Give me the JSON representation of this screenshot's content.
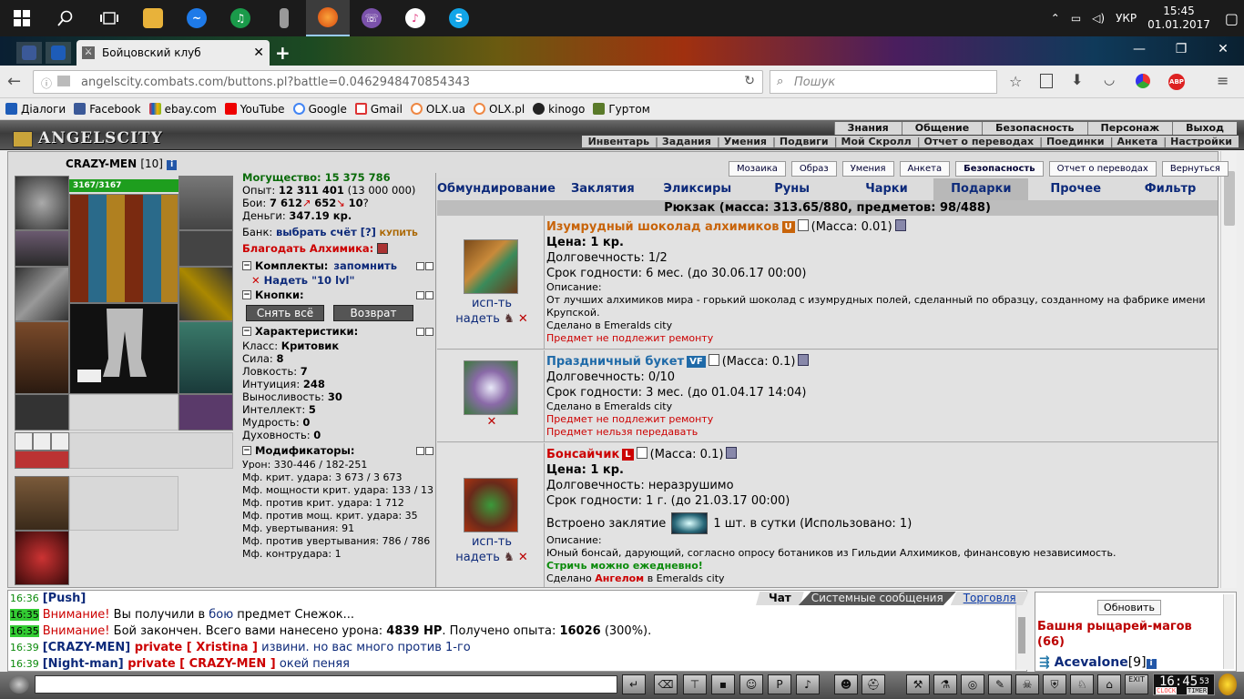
{
  "taskbar": {
    "lang": "УКР",
    "time": "15:45",
    "date": "01.01.2017",
    "apps": [
      "start",
      "search",
      "task-view",
      "explorer",
      "messenger",
      "media",
      "document",
      "firefox",
      "viber",
      "itunes",
      "skype"
    ]
  },
  "browser": {
    "tab_title": "Бойцовский клуб",
    "url": "angelscity.combats.com/buttons.pl?battle=0.0462948470854343",
    "search_placeholder": "Пошук",
    "bookmarks": [
      "Діалоги",
      "Facebook",
      "ebay.com",
      "YouTube",
      "Google",
      "Gmail",
      "OLX.ua",
      "OLX.pl",
      "kinogo",
      "Гуртом"
    ],
    "abp_label": "ABP"
  },
  "game_header": {
    "logo": "ANGELSCITY",
    "top_menu": [
      "Знания",
      "Общение",
      "Безопасность",
      "Персонаж",
      "Выход"
    ],
    "sub_menu": [
      "Инвентарь",
      "Задания",
      "Умения",
      "Подвиги",
      "Мой Скролл",
      "Отчет о переводах",
      "Поединки",
      "Анкета",
      "Настройки"
    ]
  },
  "character": {
    "name": "CRAZY-MEN",
    "level": "[10]",
    "info_icon": "i",
    "hp": "3167/3167",
    "might_label": "Могущество:",
    "might": "15 375 786",
    "exp_label": "Опыт:",
    "exp": "12 311 401",
    "exp_next": "(13 000 000)",
    "fights_label": "Бои:",
    "wins": "7 612",
    "losses": "652",
    "draws": "10",
    "money_label": "Деньги:",
    "money": "347.19 кр.",
    "bank_label": "Банк:",
    "bank_link": "выбрать счёт [?]",
    "bank_buy": "КУПИТЬ",
    "alchemist": "Благодать Алхимика:",
    "sets_label": "Комплекты:",
    "sets_remember": "запомнить",
    "set_item": "Надеть \"10 lvl\"",
    "buttons_label": "Кнопки:",
    "btn_remove_all": "Снять всё",
    "btn_return": "Возврат",
    "traits_label": "Характеристики:",
    "traits": [
      {
        "k": "Класс:",
        "v": "Критовик"
      },
      {
        "k": "Сила:",
        "v": "8"
      },
      {
        "k": "Ловкость:",
        "v": "7"
      },
      {
        "k": "Интуиция:",
        "v": "248"
      },
      {
        "k": "Выносливость:",
        "v": "30"
      },
      {
        "k": "Интеллект:",
        "v": "5"
      },
      {
        "k": "Мудрость:",
        "v": "0"
      },
      {
        "k": "Духовность:",
        "v": "0"
      }
    ],
    "mods_label": "Модификаторы:",
    "mods": [
      "Урон: 330-446 / 182-251",
      "Мф. крит. удара: 3 673 / 3 673",
      "Мф. мощности крит. удара: 133 / 13",
      "Мф. против крит. удара: 1 712",
      "Мф. против мощ. крит. удара: 35",
      "Мф. увертывания: 91",
      "Мф. против увертывания: 786 / 786",
      "Мф. контрудара: 1"
    ]
  },
  "top_buttons": [
    "Мозаика",
    "Образ",
    "Умения",
    "Анкета",
    "Безопасность",
    "Отчет о переводах",
    "Вернуться"
  ],
  "tabs": [
    "Обмундирование",
    "Заклятия",
    "Эликсиры",
    "Руны",
    "Чарки",
    "Подарки",
    "Прочее",
    "Фильтр"
  ],
  "active_tab": "Подарки",
  "backpack_title": "Рюкзак (масса: 313.65/880, предметов: 98/488)",
  "actions": {
    "use": "исп-ть",
    "wear": "надеть"
  },
  "items": [
    {
      "name": "Изумрудный шоколад алхимиков",
      "badge": "U",
      "mass": "(Масса: 0.01)",
      "price": "Цена: 1 кр.",
      "durability": "Долговечность: 1/2",
      "expiry": "Срок годности: 6 мес. (до 30.06.17 00:00)",
      "desc_label": "Описание:",
      "desc": "От лучших алхимиков мира - горький шоколад с изумрудных полей, сделанный по образцу, созданному на фабрике имени Крупской.",
      "made": "Сделано в Emeralds city",
      "note1": "Предмет не подлежит ремонту"
    },
    {
      "name": "Праздничный букет",
      "badge": "VF",
      "mass": "(Масса: 0.1)",
      "durability": "Долговечность: 0/10",
      "expiry": "Срок годности: 3 мес. (до 01.04.17 14:04)",
      "made": "Сделано в Emeralds city",
      "note1": "Предмет не подлежит ремонту",
      "note2": "Предмет нельзя передавать"
    },
    {
      "name": "Бонсайчик",
      "badge": "L",
      "mass": "(Масса: 0.1)",
      "price": "Цена: 1 кр.",
      "durability": "Долговечность: неразрушимо",
      "expiry": "Срок годности: 1 г. (до 21.03.17 00:00)",
      "spell_pre": "Встроено заклятие",
      "spell_post": "1 шт. в сутки (Использовано: 1)",
      "desc_label": "Описание:",
      "desc": "Юный бонсай, дарующий, согласно опросу ботаников из Гильдии Алхимиков, финансовую независимость.",
      "daily": "Стричь можно ежедневно!",
      "made_pre": "Сделано",
      "made_by": "Ангелом",
      "made_post": "в Emeralds city"
    }
  ],
  "chat": {
    "tabs": [
      "Чат",
      "Системные сообщения",
      "Торговля"
    ],
    "lines": [
      {
        "t": "16:36",
        "parts": [
          {
            "c": "b",
            "s": "[Push]"
          }
        ]
      },
      {
        "t": "16:35",
        "hl": true,
        "parts": [
          {
            "c": "r",
            "s": "Внимание!"
          },
          {
            "c": "n",
            "s": " Вы получили в "
          },
          {
            "c": "bl",
            "s": "бою"
          },
          {
            "c": "n",
            "s": " предмет Снежок..."
          }
        ]
      },
      {
        "t": "16:35",
        "hl": true,
        "parts": [
          {
            "c": "r",
            "s": "Внимание!"
          },
          {
            "c": "n",
            "s": " Бой закончен. Всего вами нанесено урона: "
          },
          {
            "c": "k",
            "s": "4839 HP"
          },
          {
            "c": "n",
            "s": ". Получено опыта: "
          },
          {
            "c": "k",
            "s": "16026"
          },
          {
            "c": "n",
            "s": " (300%)."
          }
        ]
      },
      {
        "t": "16:39",
        "parts": [
          {
            "c": "b",
            "s": "[CRAZY-MEN]"
          },
          {
            "c": "rb",
            "s": " private [ Xristina ]"
          },
          {
            "c": "bl",
            "s": " извини. но вас много против 1-го"
          }
        ]
      },
      {
        "t": "16:39",
        "parts": [
          {
            "c": "b",
            "s": "[Night-man]"
          },
          {
            "c": "rb",
            "s": " private [ CRAZY-MEN ]"
          },
          {
            "c": "bl",
            "s": " окей пеняя"
          }
        ]
      }
    ]
  },
  "online": {
    "refresh": "Обновить",
    "location": "Башня рыцарей-магов",
    "count": "(66)",
    "first_user": "Acevalone",
    "first_level": "[9]"
  },
  "bottom": {
    "timer_time": "16:45",
    "timer_sec": "53",
    "exit": "EXIT",
    "clock": "CLOCK",
    "timer": "TIMER"
  }
}
